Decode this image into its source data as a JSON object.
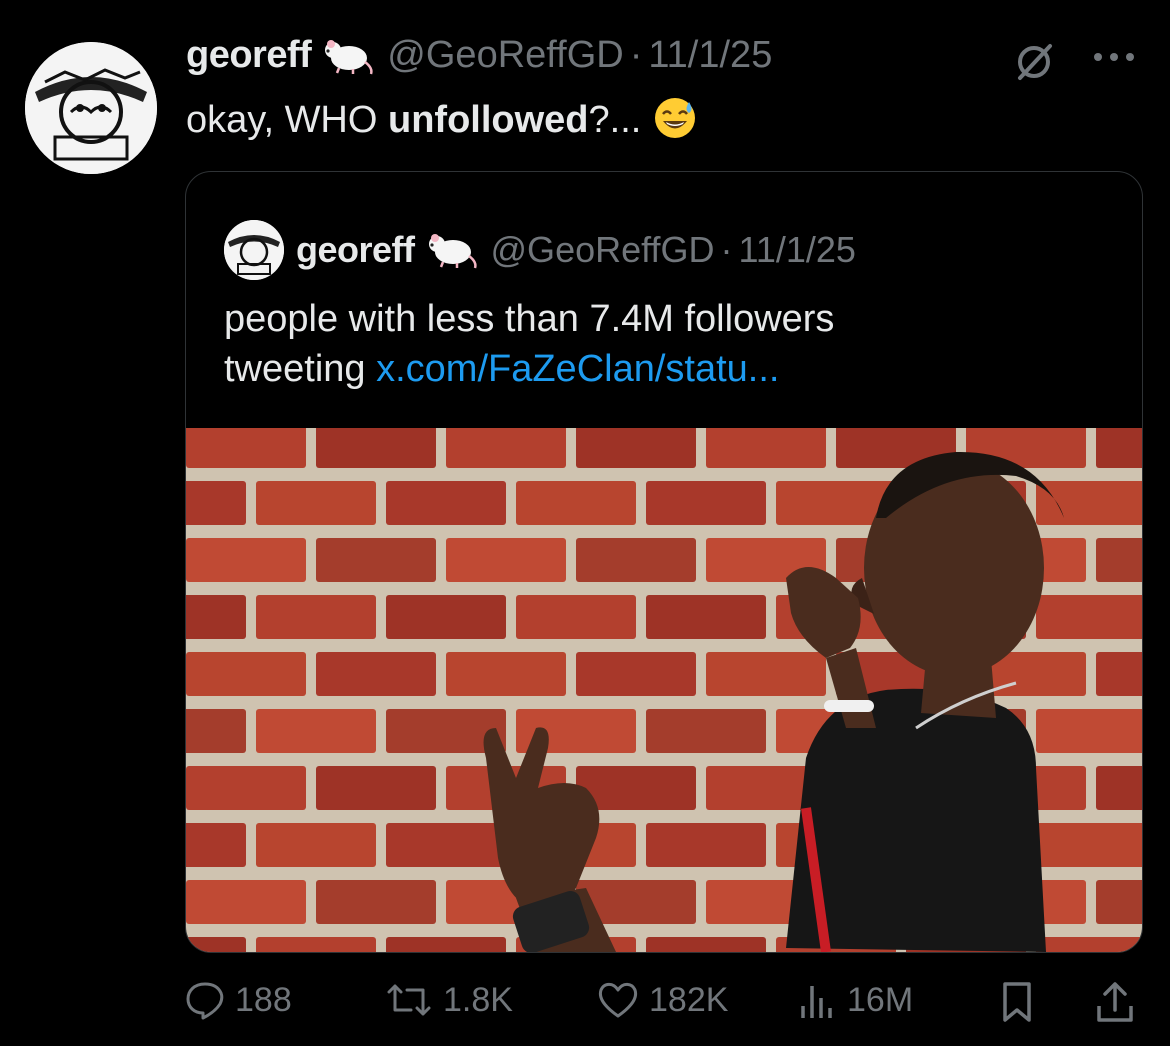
{
  "post": {
    "display_name": "georeff",
    "handle": "@GeoReffGD",
    "date": "11/1/25",
    "text_before": "okay, WHO ",
    "text_bold": "unfollowed",
    "text_after": "?...",
    "emoji": "grinning-face-with-sweat"
  },
  "quote": {
    "display_name": "georeff",
    "handle": "@GeoReffGD",
    "date": "11/1/25",
    "text_line1": "people with less than 7.4M followers",
    "text_line2_prefix": "tweeting ",
    "link_text": "x.com/FaZeClan/statu..."
  },
  "actions": {
    "replies": "188",
    "reposts": "1.8K",
    "likes": "182K",
    "views": "16M"
  },
  "colors": {
    "background": "#000000",
    "text": "#e7e9ea",
    "muted": "#71767b",
    "link": "#1d9bf0",
    "border": "#2f3336"
  },
  "icons": [
    "grok-icon",
    "more-icon",
    "reply-icon",
    "repost-icon",
    "like-icon",
    "views-icon",
    "bookmark-icon",
    "share-icon",
    "rat-emoji",
    "sweat-smile-emoji"
  ]
}
